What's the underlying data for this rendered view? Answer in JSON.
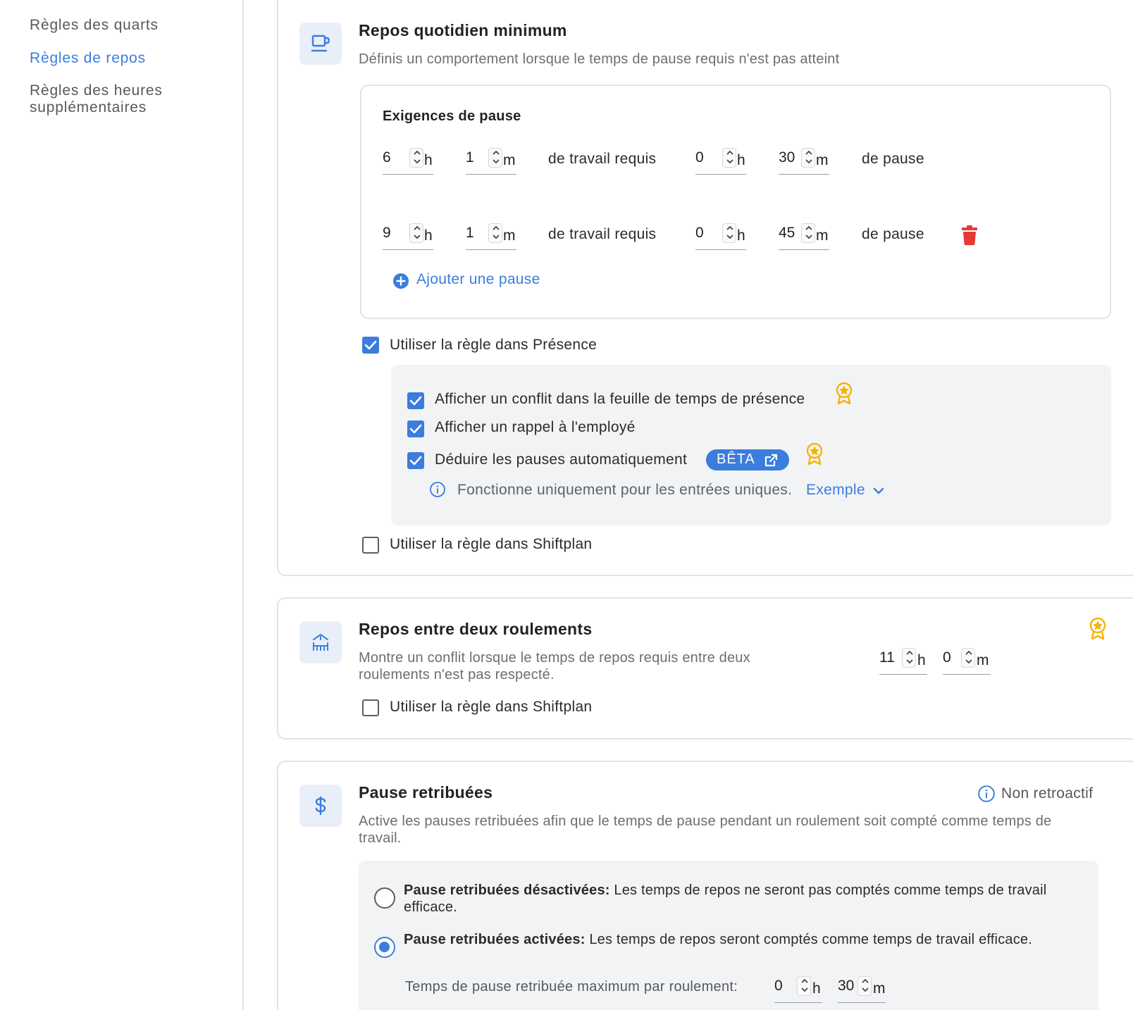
{
  "sidebar": {
    "items": [
      {
        "label": "Règles des quarts"
      },
      {
        "label": "Règles de repos"
      },
      {
        "label": "Règles des heures supplémentaires"
      }
    ]
  },
  "daily_rest": {
    "title": "Repos quotidien minimum",
    "description": "Définis un comportement lorsque le temps de pause requis n'est pas atteint",
    "requirements_title": "Exigences de pause",
    "rows": [
      {
        "work_h": "6",
        "work_m": "1",
        "label": "de travail requis",
        "break_h": "0",
        "break_m": "30",
        "suffix": "de pause"
      },
      {
        "work_h": "9",
        "work_m": "1",
        "label": "de travail requis",
        "break_h": "0",
        "break_m": "45",
        "suffix": "de pause"
      }
    ],
    "unit_h": "h",
    "unit_m": "m",
    "add_break": "Ajouter une pause",
    "use_in_presence": "Utiliser la règle dans Présence",
    "options": {
      "show_conflict": "Afficher un conflit dans la feuille de temps de présence",
      "show_reminder": "Afficher un rappel à l'employé",
      "auto_deduct": "Déduire les pauses automatiquement",
      "beta_badge": "BÊTA",
      "info": "Fonctionne uniquement pour les entrées uniques.",
      "example_link": "Exemple"
    },
    "use_in_shiftplan": "Utiliser la règle dans Shiftplan"
  },
  "rest_between_shifts": {
    "title": "Repos entre deux roulements",
    "description": "Montre un conflit lorsque le temps de repos requis entre deux roulements n'est pas respecté.",
    "hours": "11",
    "minutes": "0",
    "use_in_shiftplan": "Utiliser la règle dans Shiftplan"
  },
  "paid_breaks": {
    "title": "Pause retribuées",
    "non_retro": "Non retroactif",
    "description": "Active les pauses retribuées afin que le temps de pause pendant un roulement soit compté comme temps de travail.",
    "option_off_bold": "Pause retribuées désactivées:",
    "option_off_text": " Les temps de repos ne seront pas comptés comme temps de travail efficace.",
    "option_on_bold": "Pause retribuées activées:",
    "option_on_text": " Les temps de repos seront comptés comme temps de travail efficace.",
    "max_label": "Temps de pause retribuée maximum par roulement:",
    "max_h": "0",
    "max_m": "30"
  },
  "colors": {
    "accent": "#3b7ddd",
    "danger": "#e53935",
    "premium": "#f5b400"
  }
}
